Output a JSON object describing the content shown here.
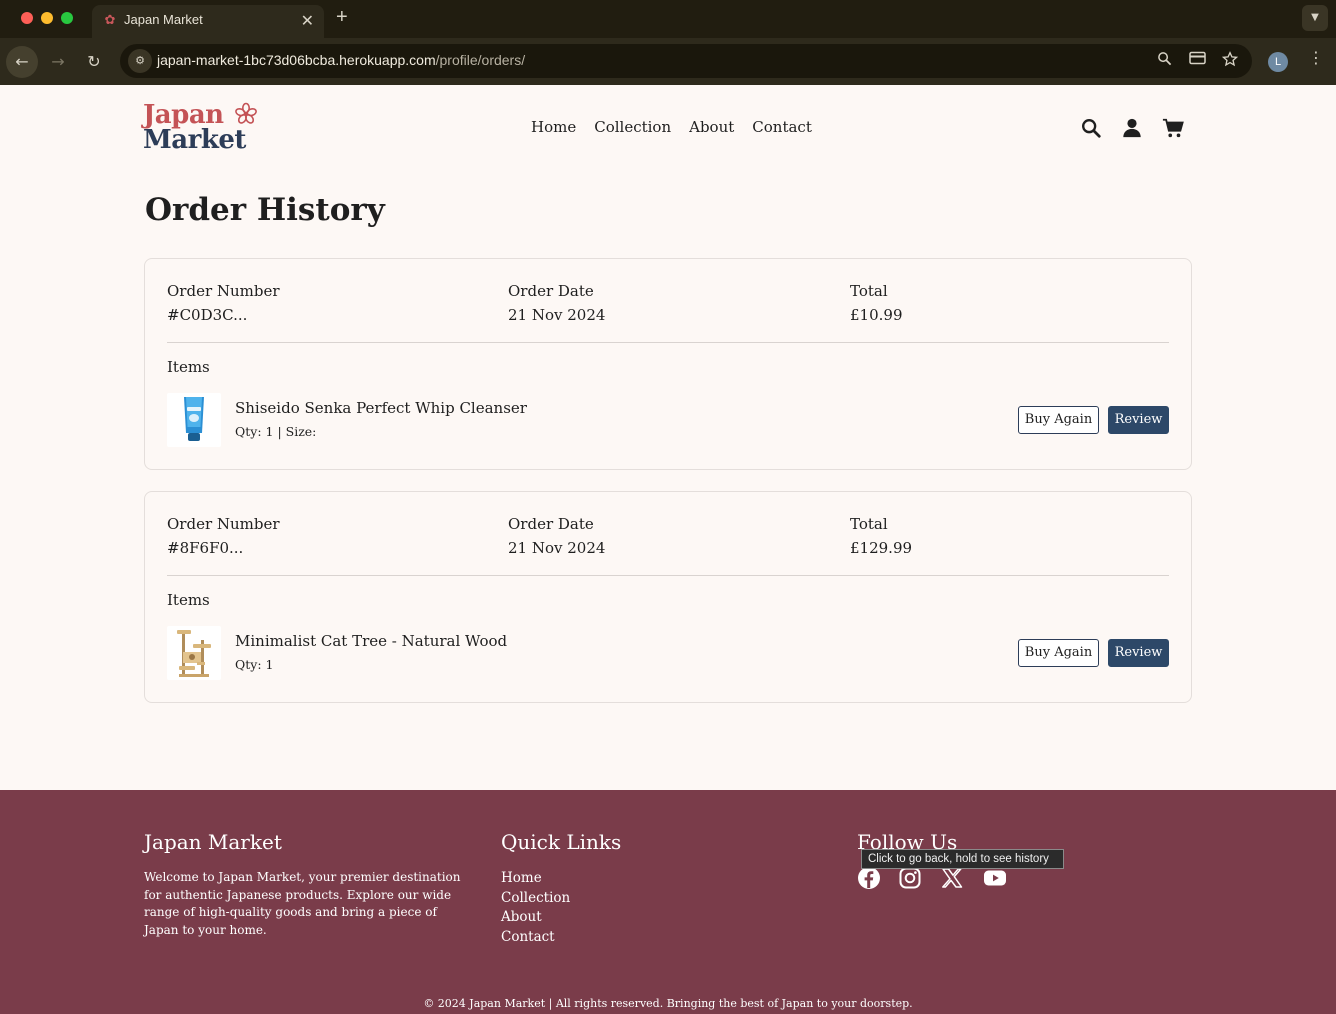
{
  "browser": {
    "tab_title": "Japan Market",
    "url_host": "japan-market-1bc73d06bcba.herokuapp.com",
    "url_path": "/profile/orders/",
    "profile_initial": "L",
    "tooltip": "Click to go back, hold to see history"
  },
  "header": {
    "logo_line1": "Japan",
    "logo_line2": "Market",
    "nav": [
      "Home",
      "Collection",
      "About",
      "Contact"
    ],
    "icons": [
      "search-icon",
      "user-icon",
      "cart-icon"
    ]
  },
  "page": {
    "title": "Order History",
    "labels": {
      "order_number": "Order Number",
      "order_date": "Order Date",
      "total": "Total",
      "items": "Items",
      "buy_again": "Buy Again",
      "review": "Review"
    },
    "orders": [
      {
        "number": "#C0D3C...",
        "date": "21 Nov 2024",
        "total": "£10.99",
        "item": {
          "name": "Shiseido Senka Perfect Whip Cleanser",
          "qty": "Qty: 1 | Size:"
        }
      },
      {
        "number": "#8F6F0...",
        "date": "21 Nov 2024",
        "total": "£129.99",
        "item": {
          "name": "Minimalist Cat Tree - Natural Wood",
          "qty": "Qty: 1"
        }
      }
    ]
  },
  "footer": {
    "about_heading": "Japan Market",
    "about_text": "Welcome to Japan Market, your premier destination for authentic Japanese products. Explore our wide range of high-quality goods and bring a piece of Japan to your home.",
    "links_heading": "Quick Links",
    "links": [
      "Home",
      "Collection",
      "About",
      "Contact"
    ],
    "follow_heading": "Follow Us",
    "social": [
      "facebook-icon",
      "instagram-icon",
      "x-icon",
      "youtube-icon"
    ],
    "copyright": "© 2024 Japan Market | All rights reserved. Bringing the best of Japan to your doorstep."
  },
  "colors": {
    "brand_red": "#c45356",
    "brand_navy": "#2d3d58",
    "footer_bg": "#7a3c4a",
    "page_bg": "#fdf8f5"
  }
}
